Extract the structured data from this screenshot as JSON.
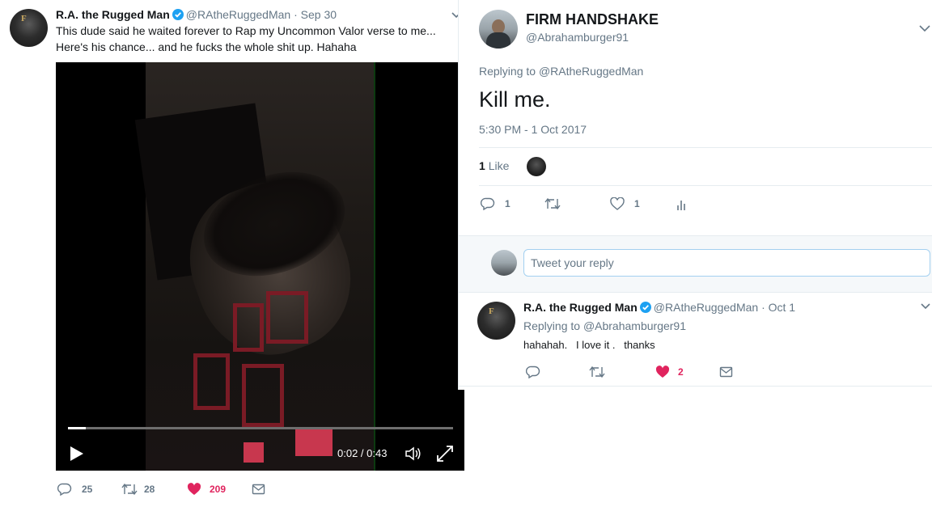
{
  "left_tweet": {
    "author_name": "R.A. the Rugged Man",
    "author_handle": "@RAtheRuggedMan",
    "separator": "·",
    "date": "Sep 30",
    "text_line1": "This dude said he waited forever to Rap my Uncommon Valor verse to me...",
    "text_line2": "Here's his chance... and he fucks the whole shit up. Hahaha",
    "video": {
      "time": "0:02 / 0:43",
      "progress": 0.047
    },
    "actions": {
      "replies": "25",
      "retweets": "28",
      "likes": "209"
    }
  },
  "right_tweet": {
    "author_name": "FIRM HANDSHAKE",
    "author_handle": "@Abrahamburger91",
    "replying_prefix": "Replying to",
    "replying_to": "@RAtheRuggedMan",
    "text": "Kill me.",
    "timestamp": "5:30 PM - 1 Oct 2017",
    "likes_count": "1",
    "likes_label": "Like",
    "actions": {
      "replies": "1",
      "retweets": "",
      "likes": "1"
    },
    "reply_placeholder": "Tweet your reply"
  },
  "reply_tweet": {
    "author_name": "R.A. the Rugged Man",
    "author_handle": "@RAtheRuggedMan",
    "separator": "·",
    "date": "Oct 1",
    "replying_prefix": "Replying to",
    "replying_to": "@Abrahamburger91",
    "text": "hahahah.   I love it .   thanks",
    "actions": {
      "likes": "2"
    }
  },
  "colors": {
    "like_red": "#e0245e",
    "verified_blue": "#1da1f2",
    "muted_gray": "#657786"
  },
  "icons": [
    "verified-icon",
    "chevron-down-icon",
    "reply-icon",
    "retweet-icon",
    "heart-icon",
    "dm-icon",
    "analytics-icon",
    "play-icon",
    "volume-icon",
    "fullscreen-icon"
  ]
}
